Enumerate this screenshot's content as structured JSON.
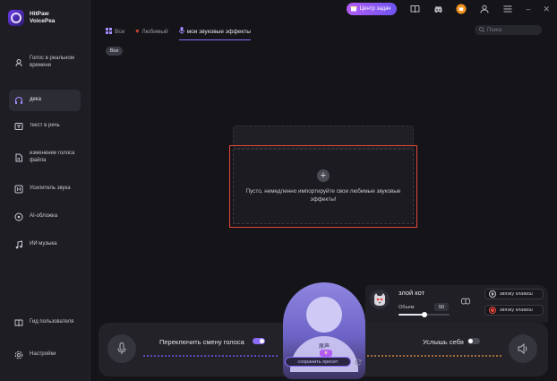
{
  "app": {
    "name": "HitPaw VoicePea"
  },
  "topbar": {
    "task_center_label": "Центр задач",
    "icons": [
      "gift-icon",
      "book-icon",
      "discord-icon",
      "shop-icon",
      "user-icon",
      "menu-icon"
    ]
  },
  "sidebar": {
    "items": [
      {
        "label": "Голос в реальном времени",
        "icon": "realtime-voice-icon",
        "active": false
      },
      {
        "label": "дека",
        "icon": "headphones-icon",
        "active": true
      },
      {
        "label": "текст в речь",
        "icon": "text-speech-icon",
        "active": false
      },
      {
        "label": "изменение голоса файла",
        "icon": "file-voice-icon",
        "active": false
      },
      {
        "label": "Усилитель звука",
        "icon": "equalizer-icon",
        "active": false
      },
      {
        "label": "AI-обложка",
        "icon": "ai-cover-icon",
        "active": false
      },
      {
        "label": "ИИ музыка",
        "icon": "music-icon",
        "active": false
      }
    ],
    "bottom_items": [
      {
        "label": "Гид пользователя",
        "icon": "guide-icon"
      },
      {
        "label": "Настройки",
        "icon": "settings-icon"
      }
    ]
  },
  "tabs": [
    {
      "label": "Все",
      "icon": "grid-icon",
      "active": false
    },
    {
      "label": "Любимый",
      "icon": "heart-icon",
      "active": false
    },
    {
      "label": "мои звуковые эффекты",
      "icon": "mic-icon",
      "active": true
    }
  ],
  "search": {
    "placeholder": "Поиск"
  },
  "filter_chip": "Все",
  "empty_state": {
    "message": "Пустo, немедленно импортируйте свои любимые звуковые эффекты!"
  },
  "bottom": {
    "switch_label": "Переключить смену голоса",
    "switch_on": true,
    "hear_self_label": "Услышь себя",
    "hear_self_on": false,
    "avatar_name": "原声",
    "save_preset_label": "сохранить пресет"
  },
  "effect": {
    "name": "злой кот",
    "volume_label": "Объем",
    "volume_value": "50",
    "volume_fraction": 0.5,
    "key_bind_play_label": "звязку клавиш",
    "key_bind_rec_label": "звязку клавиш"
  },
  "colors": {
    "accent": "#8a6cf5",
    "highlight_border": "#e8473d",
    "background": "#151519"
  }
}
